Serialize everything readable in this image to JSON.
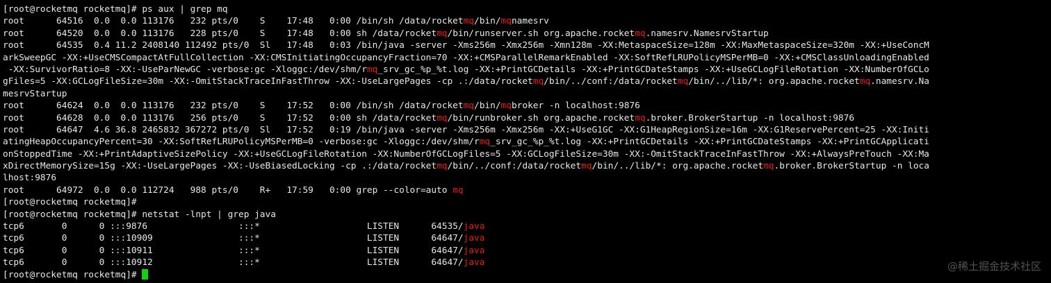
{
  "terminal": {
    "highlight_color": "#e81b1b",
    "cursor_color": "#10d010",
    "lines": [
      [
        {
          "t": "[root@rocketmq rocketmq]# ps aux | grep mq"
        }
      ],
      [
        {
          "t": "root      64516  0.0  0.0 113176   232 pts/0    S    17:48   0:00 /bin/sh /data/rocket"
        },
        {
          "t": "mq",
          "h": true
        },
        {
          "t": "/bin/"
        },
        {
          "t": "mq",
          "h": true
        },
        {
          "t": "namesrv"
        }
      ],
      [
        {
          "t": "root      64520  0.0  0.0 113176   228 pts/0    S    17:48   0:00 sh /data/rocket"
        },
        {
          "t": "mq",
          "h": true
        },
        {
          "t": "/bin/runserver.sh org.apache.rocket"
        },
        {
          "t": "mq",
          "h": true
        },
        {
          "t": ".namesrv.NamesrvStartup"
        }
      ],
      [
        {
          "t": "root      64535  0.4 11.2 2408140 112492 pts/0  Sl   17:48   0:03 /bin/java -server -Xms256m -Xmx256m -Xmn128m -XX:MetaspaceSize=128m -XX:MaxMetaspaceSize=320m -XX:+UseConcM"
        }
      ],
      [
        {
          "t": "arkSweepGC -XX:+UseCMSCompactAtFullCollection -XX:CMSInitiatingOccupancyFraction=70 -XX:+CMSParallelRemarkEnabled -XX:SoftRefLRUPolicyMSPerMB=0 -XX:+CMSClassUnloadingEnabled"
        }
      ],
      [
        {
          "t": " -XX:SurvivorRatio=8 -XX:-UseParNewGC -verbose:gc -Xloggc:/dev/shm/r"
        },
        {
          "t": "mq",
          "h": true
        },
        {
          "t": "_srv_gc_%p_%t.log -XX:+PrintGCDetails -XX:+PrintGCDateStamps -XX:+UseGCLogFileRotation -XX:NumberOfGCLo"
        }
      ],
      [
        {
          "t": "gFiles=5 -XX:GCLogFileSize=30m -XX:-OmitStackTraceInFastThrow -XX:-UseLargePages -cp .:/data/rocket"
        },
        {
          "t": "mq",
          "h": true
        },
        {
          "t": "/bin/../conf:/data/rocket"
        },
        {
          "t": "mq",
          "h": true
        },
        {
          "t": "/bin/../lib/*: org.apache.rocket"
        },
        {
          "t": "mq",
          "h": true
        },
        {
          "t": ".namesrv.Na"
        }
      ],
      [
        {
          "t": "mesrvStartup"
        }
      ],
      [
        {
          "t": "root      64624  0.0  0.0 113176   232 pts/0    S    17:52   0:00 /bin/sh /data/rocket"
        },
        {
          "t": "mq",
          "h": true
        },
        {
          "t": "/bin/"
        },
        {
          "t": "mq",
          "h": true
        },
        {
          "t": "broker -n localhost:9876"
        }
      ],
      [
        {
          "t": "root      64628  0.0  0.0 113176   256 pts/0    S    17:52   0:00 sh /data/rocket"
        },
        {
          "t": "mq",
          "h": true
        },
        {
          "t": "/bin/runbroker.sh org.apache.rocket"
        },
        {
          "t": "mq",
          "h": true
        },
        {
          "t": ".broker.BrokerStartup -n localhost:9876"
        }
      ],
      [
        {
          "t": "root      64647  4.6 36.8 2465832 367272 pts/0  Sl   17:52   0:19 /bin/java -server -Xms256m -Xmx256m -XX:+UseG1GC -XX:G1HeapRegionSize=16m -XX:G1ReservePercent=25 -XX:Initi"
        }
      ],
      [
        {
          "t": "atingHeapOccupancyPercent=30 -XX:SoftRefLRUPolicyMSPerMB=0 -verbose:gc -Xloggc:/dev/shm/r"
        },
        {
          "t": "mq",
          "h": true
        },
        {
          "t": "_srv_gc_%p_%t.log -XX:+PrintGCDetails -XX:+PrintGCDateStamps -XX:+PrintGCApplicati"
        }
      ],
      [
        {
          "t": "onStoppedTime -XX:+PrintAdaptiveSizePolicy -XX:+UseGCLogFileRotation -XX:NumberOfGCLogFiles=5 -XX:GCLogFileSize=30m -XX:-OmitStackTraceInFastThrow -XX:+AlwaysPreTouch -XX:Ma"
        }
      ],
      [
        {
          "t": "xDirectMemorySize=15g -XX:-UseLargePages -XX:-UseBiasedLocking -cp .:/data/rocket"
        },
        {
          "t": "mq",
          "h": true
        },
        {
          "t": "/bin/../conf:/data/rocket"
        },
        {
          "t": "mq",
          "h": true
        },
        {
          "t": "/bin/../lib/*: org.apache.rocket"
        },
        {
          "t": "mq",
          "h": true
        },
        {
          "t": ".broker.BrokerStartup -n loca"
        }
      ],
      [
        {
          "t": "lhost:9876"
        }
      ],
      [
        {
          "t": "root      64972  0.0  0.0 112724   988 pts/0    R+   17:59   0:00 grep --color=auto "
        },
        {
          "t": "mq",
          "h": true
        }
      ],
      [
        {
          "t": "[root@rocketmq rocketmq]#"
        }
      ],
      [
        {
          "t": "[root@rocketmq rocketmq]# netstat -lnpt | grep java"
        }
      ],
      [
        {
          "t": "tcp6       0      0 :::9876                 :::*                    LISTEN      64535/"
        },
        {
          "t": "java",
          "h": true
        }
      ],
      [
        {
          "t": "tcp6       0      0 :::10909                :::*                    LISTEN      64647/"
        },
        {
          "t": "java",
          "h": true
        }
      ],
      [
        {
          "t": "tcp6       0      0 :::10911                :::*                    LISTEN      64647/"
        },
        {
          "t": "java",
          "h": true
        }
      ],
      [
        {
          "t": "tcp6       0      0 :::10912                :::*                    LISTEN      64647/"
        },
        {
          "t": "java",
          "h": true
        }
      ],
      [
        {
          "t": "[root@rocketmq rocketmq]# "
        }
      ]
    ]
  },
  "watermark": {
    "text": "@稀土掘金技术社区"
  }
}
